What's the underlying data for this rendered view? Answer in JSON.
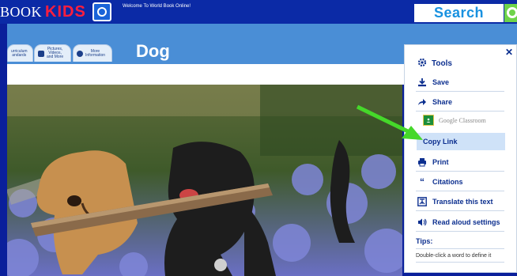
{
  "header": {
    "logo_book": "BOOK",
    "logo_kids": "KIDS",
    "welcome": "Welcome To World Book Online!",
    "search_label": "Search"
  },
  "nav": {
    "tabs": [
      {
        "label": "urriculum\nandards"
      },
      {
        "label": "Pictures,\nVideos,\nand More"
      },
      {
        "label": "More\nInformation"
      }
    ]
  },
  "article": {
    "title": "Dog"
  },
  "tools": {
    "heading": "Tools",
    "items": [
      {
        "label": "Save",
        "icon": "download-icon"
      },
      {
        "label": "Share",
        "icon": "share-arrow-icon"
      },
      {
        "label": "Google Classroom",
        "icon": "google-classroom-icon"
      },
      {
        "label": "Copy Link",
        "icon": "link-icon"
      },
      {
        "label": "Print",
        "icon": "printer-icon"
      },
      {
        "label": "Citations",
        "icon": "quote-icon"
      },
      {
        "label": "Translate this text",
        "icon": "translate-icon"
      },
      {
        "label": "Read aloud settings",
        "icon": "speaker-icon"
      }
    ],
    "tips_heading": "Tips:",
    "tips_text": "Double-click a word to define it"
  },
  "colors": {
    "header_bg": "#0b2aa6",
    "nav_band": "#4a8ed6",
    "accent_green": "#6ed34a",
    "highlight": "#cfe2f8",
    "tools_text": "#0c2f8f"
  }
}
